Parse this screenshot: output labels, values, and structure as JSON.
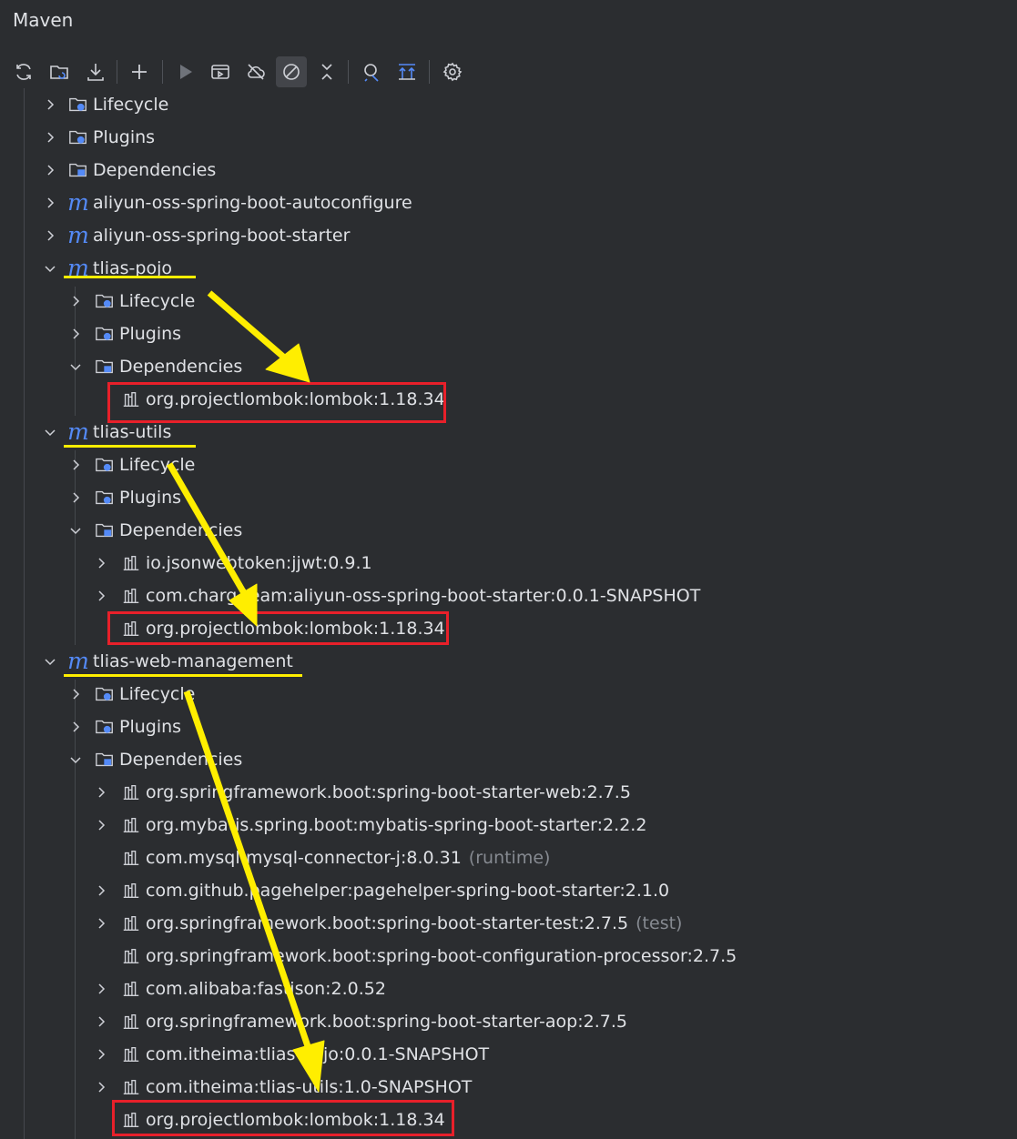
{
  "panel": {
    "title": "Maven"
  },
  "toolbar": {
    "buttons": [
      {
        "icon": "reload-icon"
      },
      {
        "icon": "reload-folder-icon"
      },
      {
        "icon": "download-icon"
      },
      {
        "icon": "add-icon"
      },
      {
        "icon": "run-icon"
      },
      {
        "icon": "run-config-icon"
      },
      {
        "icon": "offline-icon"
      },
      {
        "icon": "skip-tests-icon"
      },
      {
        "icon": "collapse-icon"
      },
      {
        "icon": "analyze-dependencies-icon"
      },
      {
        "icon": "show-dependencies-icon"
      },
      {
        "icon": "settings-icon"
      }
    ]
  },
  "tree": {
    "root_children": [
      {
        "label": "Lifecycle",
        "icon": "lifecycle-folder-icon"
      },
      {
        "label": "Plugins",
        "icon": "plugins-folder-icon"
      },
      {
        "label": "Dependencies",
        "icon": "dependencies-folder-icon"
      }
    ],
    "modules_collapsed": [
      {
        "label": "aliyun-oss-spring-boot-autoconfigure"
      },
      {
        "label": "aliyun-oss-spring-boot-starter"
      }
    ],
    "pojo": {
      "label": "tlias-pojo",
      "lifecycle": "Lifecycle",
      "plugins": "Plugins",
      "dependencies": "Dependencies",
      "deps": [
        {
          "label": "org.projectlombok:lombok:1.18.34",
          "scope": ""
        }
      ]
    },
    "utils": {
      "label": "tlias-utils",
      "lifecycle": "Lifecycle",
      "plugins": "Plugins",
      "dependencies": "Dependencies",
      "deps": [
        {
          "label": "io.jsonwebtoken:jjwt:0.9.1",
          "scope": ""
        },
        {
          "label": "com.charg.team:aliyun-oss-spring-boot-starter:0.0.1-SNAPSHOT",
          "scope": ""
        },
        {
          "label": "org.projectlombok:lombok:1.18.34",
          "scope": ""
        }
      ]
    },
    "web": {
      "label": "tlias-web-management",
      "lifecycle": "Lifecycle",
      "plugins": "Plugins",
      "dependencies": "Dependencies",
      "deps": [
        {
          "label": "org.springframework.boot:spring-boot-starter-web:2.7.5",
          "scope": ""
        },
        {
          "label": "org.mybatis.spring.boot:mybatis-spring-boot-starter:2.2.2",
          "scope": ""
        },
        {
          "label": "com.mysql:mysql-connector-j:8.0.31",
          "scope": "(runtime)"
        },
        {
          "label": "com.github.pagehelper:pagehelper-spring-boot-starter:2.1.0",
          "scope": ""
        },
        {
          "label": "org.springframework.boot:spring-boot-starter-test:2.7.5",
          "scope": "(test)"
        },
        {
          "label": "org.springframework.boot:spring-boot-configuration-processor:2.7.5",
          "scope": ""
        },
        {
          "label": "com.alibaba:fastjson:2.0.52",
          "scope": ""
        },
        {
          "label": "org.springframework.boot:spring-boot-starter-aop:2.7.5",
          "scope": ""
        },
        {
          "label": "com.itheima:tlias-pojo:0.0.1-SNAPSHOT",
          "scope": ""
        },
        {
          "label": "com.itheima:tlias-utils:1.0-SNAPSHOT",
          "scope": ""
        },
        {
          "label": "org.projectlombok:lombok:1.18.34",
          "scope": ""
        }
      ]
    }
  },
  "colors": {
    "background": "#2b2d30",
    "text": "#dfe1e5",
    "muted": "#868a91",
    "module_icon": "#548af7",
    "annotation_box": "#e8202a",
    "annotation_marker": "#ffee00"
  }
}
